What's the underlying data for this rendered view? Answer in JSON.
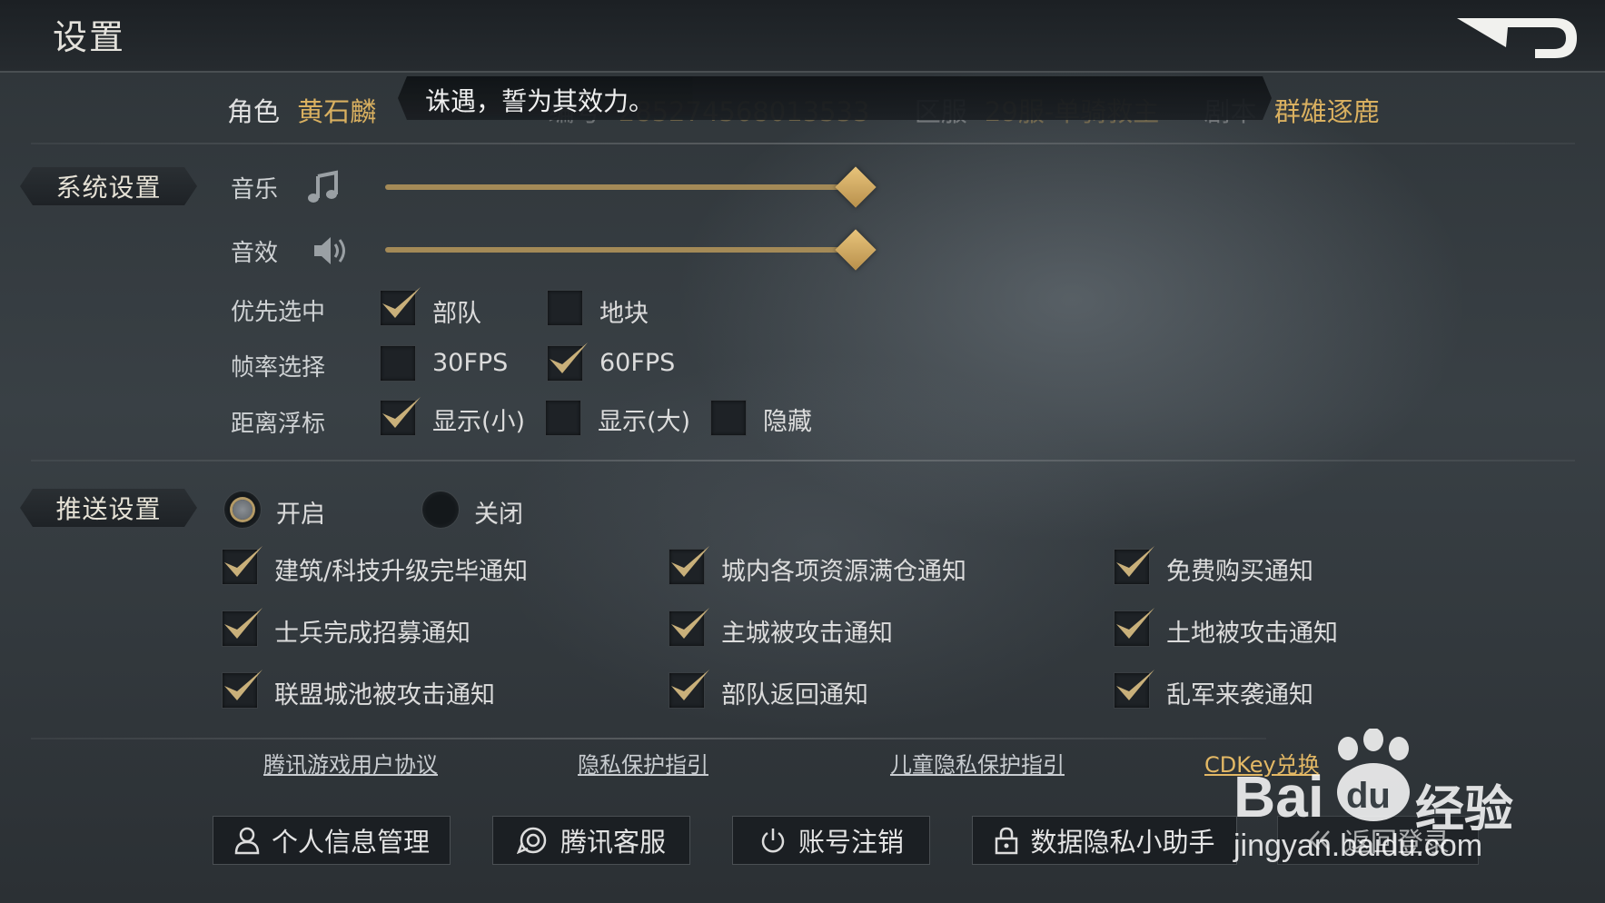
{
  "header": {
    "title": "设置"
  },
  "info": {
    "role_label": "角色",
    "role_value": "黄石麟",
    "id_label": "编号",
    "id_value": "2852745680135​33",
    "server_label": "区服",
    "server_value": "29服-单骑救主",
    "script_label": "剧本",
    "script_value": "群雄逐鹿"
  },
  "toast": {
    "text": "诛遇，誓为其效力。"
  },
  "system": {
    "tab": "系统设置",
    "music": {
      "label": "音乐",
      "icon": "music-note-icon",
      "level": 1.0
    },
    "sfx": {
      "label": "音效",
      "icon": "speaker-icon",
      "level": 1.0
    },
    "priority": {
      "label": "优先选中",
      "options": [
        {
          "label": "部队",
          "checked": true
        },
        {
          "label": "地块",
          "checked": false
        }
      ]
    },
    "fps": {
      "label": "帧率选择",
      "options": [
        {
          "label": "30FPS",
          "checked": false
        },
        {
          "label": "60FPS",
          "checked": true
        }
      ]
    },
    "marker": {
      "label": "距离浮标",
      "options": [
        {
          "label": "显示(小)",
          "checked": true
        },
        {
          "label": "显示(大)",
          "checked": false
        },
        {
          "label": "隐藏",
          "checked": false
        }
      ]
    }
  },
  "push": {
    "tab": "推送设置",
    "on_label": "开启",
    "off_label": "关闭",
    "enabled": true,
    "items": [
      {
        "label": "建筑/科技升级完毕通知",
        "checked": true
      },
      {
        "label": "城内各项资源满仓通知",
        "checked": true
      },
      {
        "label": "免费购买通知",
        "checked": true
      },
      {
        "label": "士兵完成招募通知",
        "checked": true
      },
      {
        "label": "主城被攻击通知",
        "checked": true
      },
      {
        "label": "土地被攻击通知",
        "checked": true
      },
      {
        "label": "联盟城池被攻击通知",
        "checked": true
      },
      {
        "label": "部队返回通知",
        "checked": true
      },
      {
        "label": "乱军来袭通知",
        "checked": true
      }
    ]
  },
  "links": {
    "user_agreement": "腾讯游戏用户协议",
    "privacy_guide": "隐私保护指引",
    "child_privacy": "儿童隐私保护指引",
    "cdkey": "CDKey兑换"
  },
  "buttons": {
    "personal_info": "个人信息管理",
    "customer_service": "腾讯客服",
    "account_cancel": "账号注销",
    "privacy_helper": "数据隐私小助手",
    "back_login": "返回登录"
  },
  "watermark": {
    "brand": "Bai",
    "brand2": "du",
    "cn": "经验",
    "url": "jingyan.baidu.com"
  },
  "colors": {
    "accent": "#d9b060",
    "check": "#c9b07a",
    "slider": "#a48a57"
  }
}
